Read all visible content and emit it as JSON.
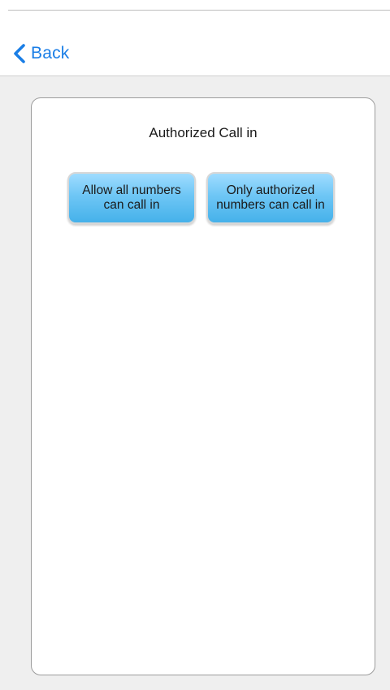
{
  "nav": {
    "back_label": "Back"
  },
  "card": {
    "title": "Authorized Call in",
    "buttons": [
      {
        "label": "Allow all numbers\ncan call in"
      },
      {
        "label": "Only  authorized\nnumbers can call in"
      }
    ]
  },
  "colors": {
    "accent": "#1a7ee6",
    "button_top": "#9fdcff",
    "button_bottom": "#45b1ea",
    "background": "#efefef"
  },
  "icons": {
    "back": "chevron-left-icon"
  }
}
